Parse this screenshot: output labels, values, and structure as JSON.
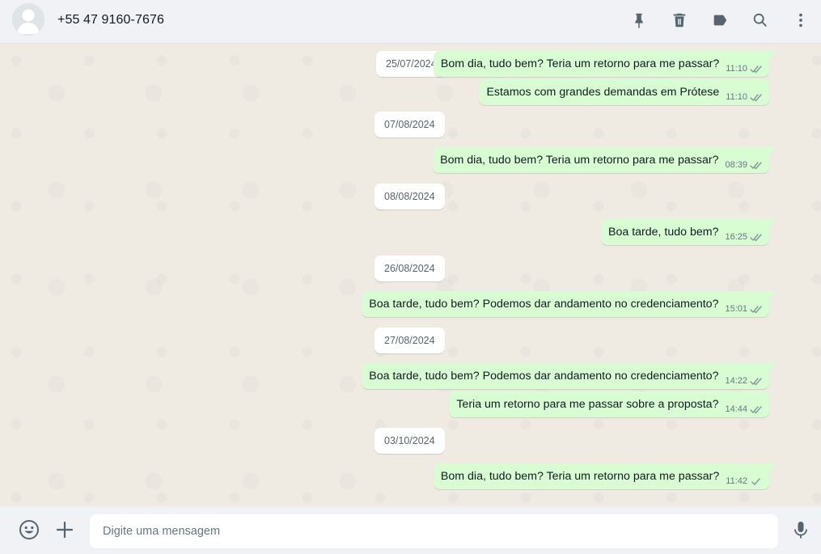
{
  "header": {
    "contact_name": "+55 47 9160-7676",
    "actions": [
      "pin-icon",
      "delete-icon",
      "label-icon",
      "search-icon",
      "menu-icon"
    ]
  },
  "chat": {
    "items": [
      {
        "type": "date",
        "label": "25/07/2024"
      },
      {
        "type": "msg",
        "text": "Bom dia, tudo bem? Teria um retorno para me passar?",
        "time": "11:10",
        "status": "read"
      },
      {
        "type": "msg",
        "text": "Estamos com grandes demandas em Prótese",
        "time": "11:10",
        "status": "read"
      },
      {
        "type": "date",
        "label": "07/08/2024"
      },
      {
        "type": "msg",
        "text": "Bom dia, tudo bem? Teria um retorno para me passar?",
        "time": "08:39",
        "status": "read"
      },
      {
        "type": "date",
        "label": "08/08/2024"
      },
      {
        "type": "msg",
        "text": "Boa tarde, tudo bem?",
        "time": "16:25",
        "status": "read"
      },
      {
        "type": "date",
        "label": "26/08/2024"
      },
      {
        "type": "msg",
        "text": "Boa tarde, tudo bem? Podemos dar andamento no credenciamento?",
        "time": "15:01",
        "status": "read"
      },
      {
        "type": "date",
        "label": "27/08/2024"
      },
      {
        "type": "msg",
        "text": "Boa tarde, tudo bem? Podemos dar andamento no credenciamento?",
        "time": "14:22",
        "status": "read"
      },
      {
        "type": "msg",
        "text": "Teria um retorno para me passar sobre a proposta?",
        "time": "14:44",
        "status": "read"
      },
      {
        "type": "date",
        "label": "03/10/2024"
      },
      {
        "type": "msg",
        "text": "Bom dia, tudo bem? Teria um retorno para me passar?",
        "time": "11:42",
        "status": "sent"
      }
    ]
  },
  "footer": {
    "placeholder": "Digite uma mensagem",
    "value": ""
  },
  "colors": {
    "outgoing_bubble": "#d9fdd3",
    "chat_background": "#efeae2",
    "panel": "#f0f2f5",
    "icon": "#54656f"
  }
}
